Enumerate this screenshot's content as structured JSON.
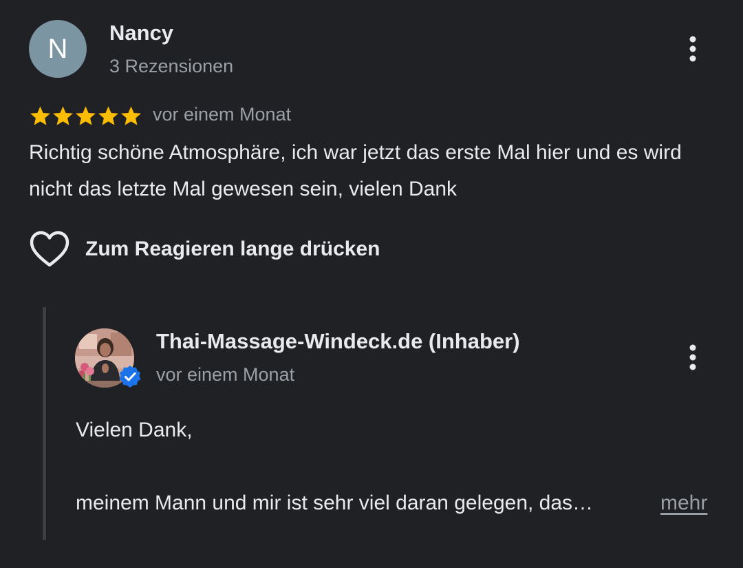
{
  "review": {
    "reviewer_initial": "N",
    "reviewer_name": "Nancy",
    "review_count": "3 Rezensionen",
    "rating": 5,
    "rating_max": 5,
    "date": "vor einem Monat",
    "text": "Richtig schöne Atmosphäre, ich war jetzt das erste Mal hier und es wird nicht das letzte Mal gewesen sein, vielen Dank",
    "react_label": "Zum Reagieren lange drücken"
  },
  "reply": {
    "owner_name": "Thai-Massage-Windeck.de (Inhaber)",
    "date": "vor einem Monat",
    "greeting": "Vielen Dank,",
    "text": "meinem Mann und mir ist sehr viel daran gelegen, das…",
    "more_label": "mehr"
  },
  "icons": {
    "review_menu": "more-vert-icon",
    "reply_menu": "more-vert-icon",
    "react": "heart-outline-icon",
    "star": "star-icon",
    "verified": "verified-check-icon"
  },
  "colors": {
    "background": "#202124",
    "star": "#fbbc04",
    "verified": "#1a73e8",
    "avatar": "#7b95a3",
    "secondary_text": "#9aa0a6"
  }
}
